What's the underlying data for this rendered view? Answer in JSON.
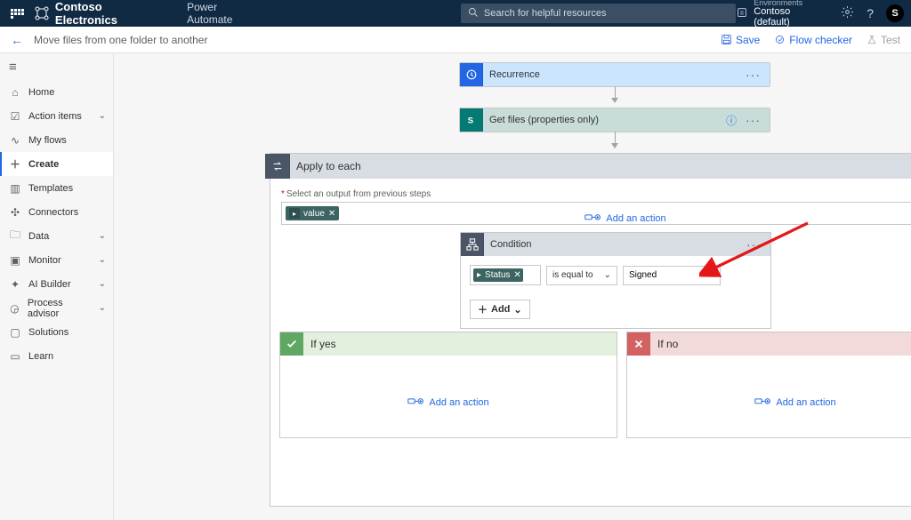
{
  "topbar": {
    "brand": "Contoso Electronics",
    "app": "Power Automate",
    "searchPlaceholder": "Search for helpful resources",
    "envLabel": "Environments",
    "envName": "Contoso (default)",
    "avatarInitial": "S"
  },
  "cmdbar": {
    "title": "Move files from one folder to another",
    "save": "Save",
    "flowChecker": "Flow checker",
    "test": "Test"
  },
  "nav": {
    "items": [
      {
        "icon": "⌂",
        "label": "Home"
      },
      {
        "icon": "☑",
        "label": "Action items",
        "chevron": true
      },
      {
        "icon": "∿",
        "label": "My flows"
      },
      {
        "icon": "＋",
        "label": "Create",
        "active": true
      },
      {
        "icon": "▥",
        "label": "Templates"
      },
      {
        "icon": "✣",
        "label": "Connectors"
      },
      {
        "icon": "🗀",
        "label": "Data",
        "chevron": true
      },
      {
        "icon": "▣",
        "label": "Monitor",
        "chevron": true
      },
      {
        "icon": "✦",
        "label": "AI Builder",
        "chevron": true
      },
      {
        "icon": "◶",
        "label": "Process advisor",
        "chevron": true
      },
      {
        "icon": "▢",
        "label": "Solutions"
      },
      {
        "icon": "▭",
        "label": "Learn"
      }
    ]
  },
  "flow": {
    "recurrence": "Recurrence",
    "getFiles": "Get files (properties only)",
    "applyToEach": "Apply to each",
    "outputLabel": "Select an output from previous steps",
    "outputToken": "value",
    "condition": "Condition",
    "condToken": "Status",
    "condOperator": "is equal to",
    "condValue": "Signed",
    "addBtn": "Add",
    "ifYes": "If yes",
    "ifNo": "If no",
    "addAction": "Add an action"
  }
}
